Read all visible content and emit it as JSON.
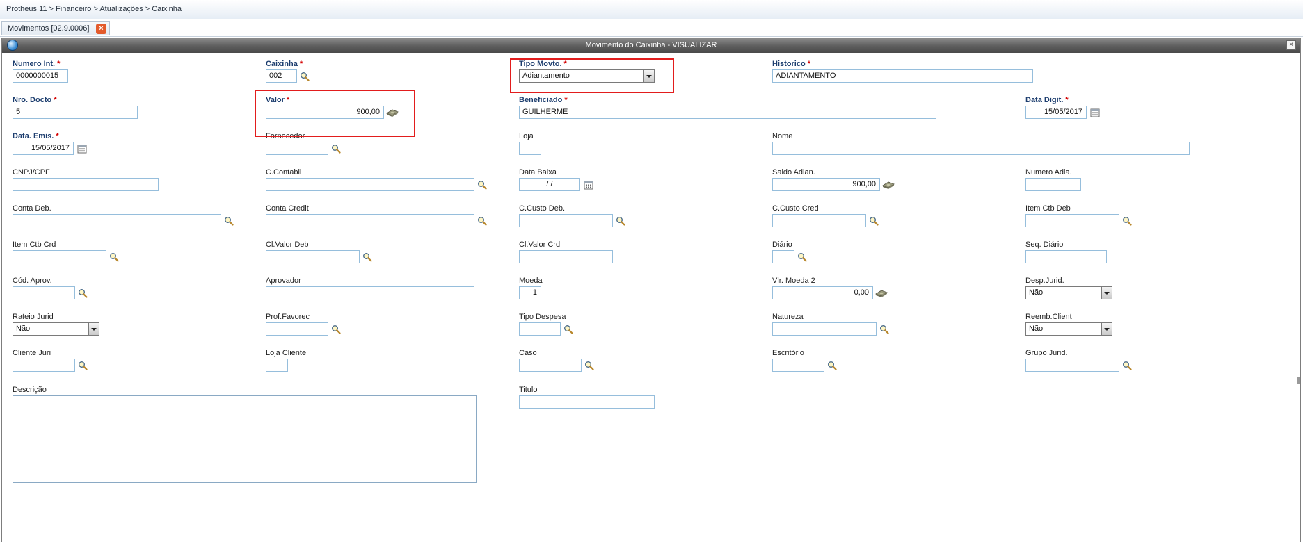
{
  "breadcrumb": "Protheus 11 > Financeiro > Atualizações > Caixinha",
  "tab": {
    "label": "Movimentos [02.9.0006]",
    "close_glyph": "×"
  },
  "window": {
    "title": "Movimento do Caixinha - VISUALIZAR",
    "close_glyph": "×"
  },
  "required_mark": "*",
  "fields": {
    "numero_int": {
      "label": "Numero Int.",
      "value": "0000000015"
    },
    "caixinha": {
      "label": "Caixinha",
      "value": "002"
    },
    "tipo_movto": {
      "label": "Tipo Movto.",
      "value": "Adiantamento"
    },
    "historico": {
      "label": "Historico",
      "value": "ADIANTAMENTO"
    },
    "nro_docto": {
      "label": "Nro. Docto",
      "value": "5"
    },
    "valor": {
      "label": "Valor",
      "value": "900,00"
    },
    "beneficiado": {
      "label": "Beneficiado",
      "value": "GUILHERME"
    },
    "data_digit": {
      "label": "Data Digit.",
      "value": "15/05/2017"
    },
    "data_emis": {
      "label": "Data. Emis.",
      "value": "15/05/2017"
    },
    "fornecedor": {
      "label": "Fornecedor",
      "value": ""
    },
    "loja": {
      "label": "Loja",
      "value": ""
    },
    "nome": {
      "label": "Nome",
      "value": ""
    },
    "cnpj_cpf": {
      "label": "CNPJ/CPF",
      "value": ""
    },
    "c_contabil": {
      "label": "C.Contabil",
      "value": ""
    },
    "data_baixa": {
      "label": "Data Baixa",
      "value": "  /  /"
    },
    "saldo_adian": {
      "label": "Saldo Adian.",
      "value": "900,00"
    },
    "numero_adia": {
      "label": "Numero Adia.",
      "value": ""
    },
    "conta_deb": {
      "label": "Conta Deb.",
      "value": ""
    },
    "conta_credit": {
      "label": "Conta Credit",
      "value": ""
    },
    "c_custo_deb": {
      "label": "C.Custo Deb.",
      "value": ""
    },
    "c_custo_cred": {
      "label": "C.Custo Cred",
      "value": ""
    },
    "item_ctb_deb": {
      "label": "Item Ctb Deb",
      "value": ""
    },
    "item_ctb_crd": {
      "label": "Item Ctb Crd",
      "value": ""
    },
    "cl_valor_deb": {
      "label": "Cl.Valor Deb",
      "value": ""
    },
    "cl_valor_crd": {
      "label": "Cl.Valor Crd",
      "value": ""
    },
    "diario": {
      "label": "Diário",
      "value": ""
    },
    "seq_diario": {
      "label": "Seq. Diário",
      "value": ""
    },
    "cod_aprov": {
      "label": "Cód. Aprov.",
      "value": ""
    },
    "aprovador": {
      "label": "Aprovador",
      "value": ""
    },
    "moeda": {
      "label": "Moeda",
      "value": "1"
    },
    "vlr_moeda_2": {
      "label": "Vlr. Moeda 2",
      "value": "0,00"
    },
    "desp_jurid": {
      "label": "Desp.Jurid.",
      "value": "Não"
    },
    "rateio_jurid": {
      "label": "Rateio Jurid",
      "value": "Não"
    },
    "prof_favorec": {
      "label": "Prof.Favorec",
      "value": ""
    },
    "tipo_despesa": {
      "label": "Tipo Despesa",
      "value": ""
    },
    "natureza": {
      "label": "Natureza",
      "value": ""
    },
    "reemb_client": {
      "label": "Reemb.Client",
      "value": "Não"
    },
    "cliente_juri": {
      "label": "Cliente Juri",
      "value": ""
    },
    "loja_cliente": {
      "label": "Loja Cliente",
      "value": ""
    },
    "caso": {
      "label": "Caso",
      "value": ""
    },
    "escritorio": {
      "label": "Escritório",
      "value": ""
    },
    "grupo_jurid": {
      "label": "Grupo Jurid.",
      "value": ""
    },
    "descricao": {
      "label": "Descrição",
      "value": ""
    },
    "titulo": {
      "label": "Titulo",
      "value": ""
    }
  },
  "colors": {
    "highlight": "#e21d1d",
    "required_label": "#1c3d6e",
    "required_star": "#d40000",
    "input_border": "#96bedc",
    "titlebar": "#5d5d5d"
  }
}
